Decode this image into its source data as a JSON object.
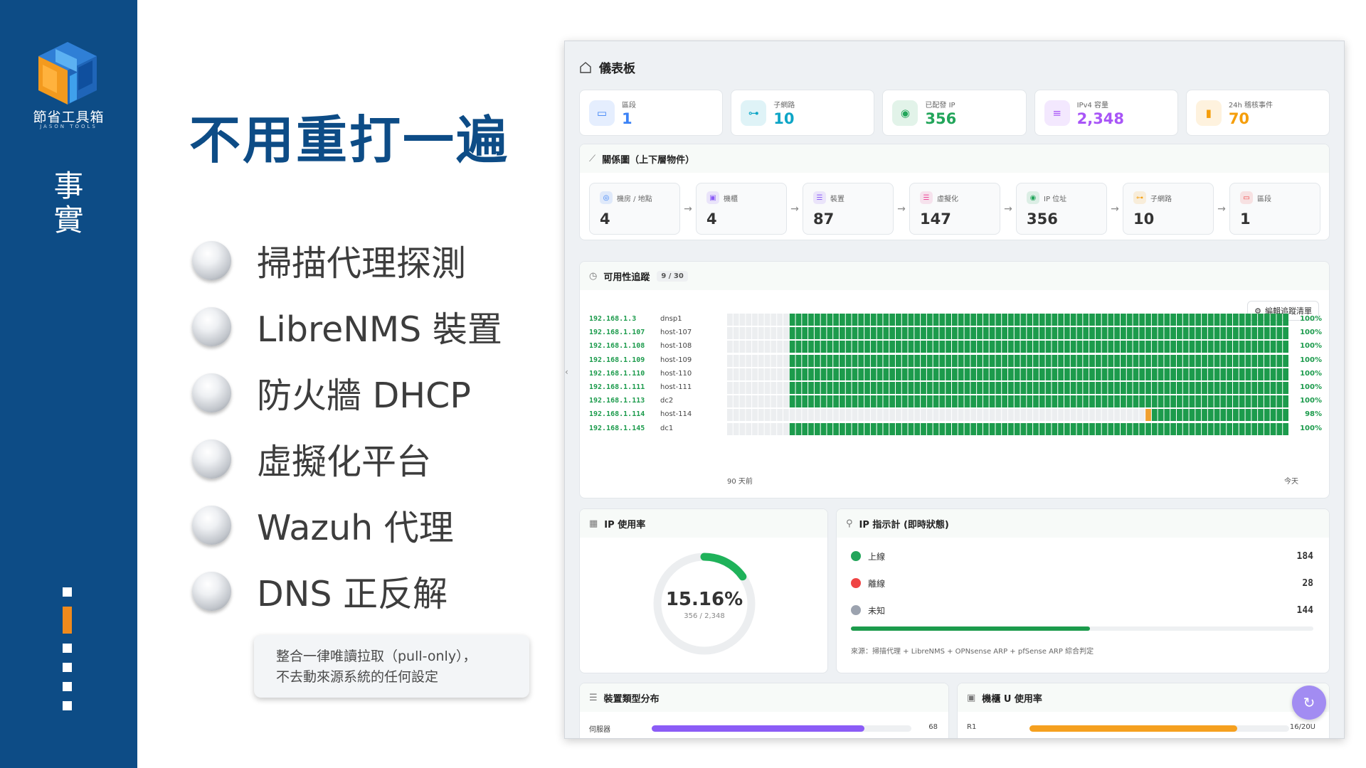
{
  "brand": {
    "name_cn": "節省工具箱",
    "name_en": "JASON TOOLS"
  },
  "section_title": "事實",
  "headline": "不用重打一遍",
  "bullets": [
    "掃描代理探測",
    "LibreNMS 裝置",
    "防火牆 DHCP",
    "虛擬化平台",
    "Wazuh 代理",
    "DNS 正反解"
  ],
  "note": {
    "line1": "整合一律唯讀拉取（pull-only），",
    "line2": "不去動來源系統的任何設定"
  },
  "slide_progress": {
    "total": 6,
    "current": 2
  },
  "dashboard": {
    "title": "儀表板",
    "kpis": [
      {
        "label": "區段",
        "value": "1",
        "color": "#3b82f6",
        "icon": "folder-icon"
      },
      {
        "label": "子網路",
        "value": "10",
        "color": "#0ea5c6",
        "icon": "network-icon"
      },
      {
        "label": "已配發 IP",
        "value": "356",
        "color": "#22a55a",
        "icon": "ip-icon"
      },
      {
        "label": "IPv4 容量",
        "value": "2,348",
        "color": "#a855f7",
        "icon": "database-icon"
      },
      {
        "label": "24h 稽核事件",
        "value": "70",
        "color": "#f59e0b",
        "icon": "bar-chart-icon"
      }
    ],
    "relations": {
      "title": "關係圖（上下層物件）",
      "items": [
        {
          "label": "機房 / 地點",
          "value": "4",
          "color": "#3b82f6",
          "icon": "location-pin-icon"
        },
        {
          "label": "機櫃",
          "value": "4",
          "color": "#8b5cf6",
          "icon": "rack-icon"
        },
        {
          "label": "裝置",
          "value": "87",
          "color": "#8b5cf6",
          "icon": "server-icon"
        },
        {
          "label": "虛擬化",
          "value": "147",
          "color": "#ec4899",
          "icon": "vm-icon"
        },
        {
          "label": "IP 位址",
          "value": "356",
          "color": "#22a55a",
          "icon": "ip-icon"
        },
        {
          "label": "子網路",
          "value": "10",
          "color": "#f59e0b",
          "icon": "network-icon"
        },
        {
          "label": "區段",
          "value": "1",
          "color": "#ef4444",
          "icon": "folder-icon"
        }
      ]
    },
    "availability": {
      "title": "可用性追蹤",
      "badge": "9 / 30",
      "edit_button": "編輯追蹤清單",
      "axis_start": "90 天前",
      "axis_end": "今天",
      "rows": [
        {
          "ip": "192.168.1.3",
          "host": "dnsp1",
          "pct": "100%",
          "nodata_days": 10,
          "down_days": []
        },
        {
          "ip": "192.168.1.107",
          "host": "host-107",
          "pct": "100%",
          "nodata_days": 10,
          "down_days": []
        },
        {
          "ip": "192.168.1.108",
          "host": "host-108",
          "pct": "100%",
          "nodata_days": 10,
          "down_days": []
        },
        {
          "ip": "192.168.1.109",
          "host": "host-109",
          "pct": "100%",
          "nodata_days": 10,
          "down_days": []
        },
        {
          "ip": "192.168.1.110",
          "host": "host-110",
          "pct": "100%",
          "nodata_days": 10,
          "down_days": []
        },
        {
          "ip": "192.168.1.111",
          "host": "host-111",
          "pct": "100%",
          "nodata_days": 10,
          "down_days": []
        },
        {
          "ip": "192.168.1.113",
          "host": "dc2",
          "pct": "100%",
          "nodata_days": 10,
          "down_days": []
        },
        {
          "ip": "192.168.1.114",
          "host": "host-114",
          "pct": "98%",
          "nodata_days": 67,
          "down_days": [
            67
          ]
        },
        {
          "ip": "192.168.1.145",
          "host": "dc1",
          "pct": "100%",
          "nodata_days": 10,
          "down_days": []
        }
      ]
    },
    "ip_usage": {
      "title": "IP 使用率",
      "percent_text": "15.16%",
      "fraction": 0.1516,
      "sub": "356 / 2,348"
    },
    "ip_indicator": {
      "title": "IP 指示計 (即時狀態)",
      "rows": [
        {
          "label": "上線",
          "value": "184",
          "color": "#22a55a"
        },
        {
          "label": "離線",
          "value": "28",
          "color": "#ef4444"
        },
        {
          "label": "未知",
          "value": "144",
          "color": "#9ca3af"
        }
      ],
      "online_fraction": 0.517,
      "source": "來源：掃描代理 + LibreNMS + OPNsense ARP + pfSense ARP 綜合判定"
    },
    "device_types": {
      "title": "裝置類型分布",
      "row_label": "伺服器",
      "row_value": "68",
      "fraction": 0.82
    },
    "rack_usage": {
      "title": "機櫃 U 使用率",
      "row_label": "R1",
      "row_value": "16/20U",
      "fraction": 0.8
    }
  }
}
